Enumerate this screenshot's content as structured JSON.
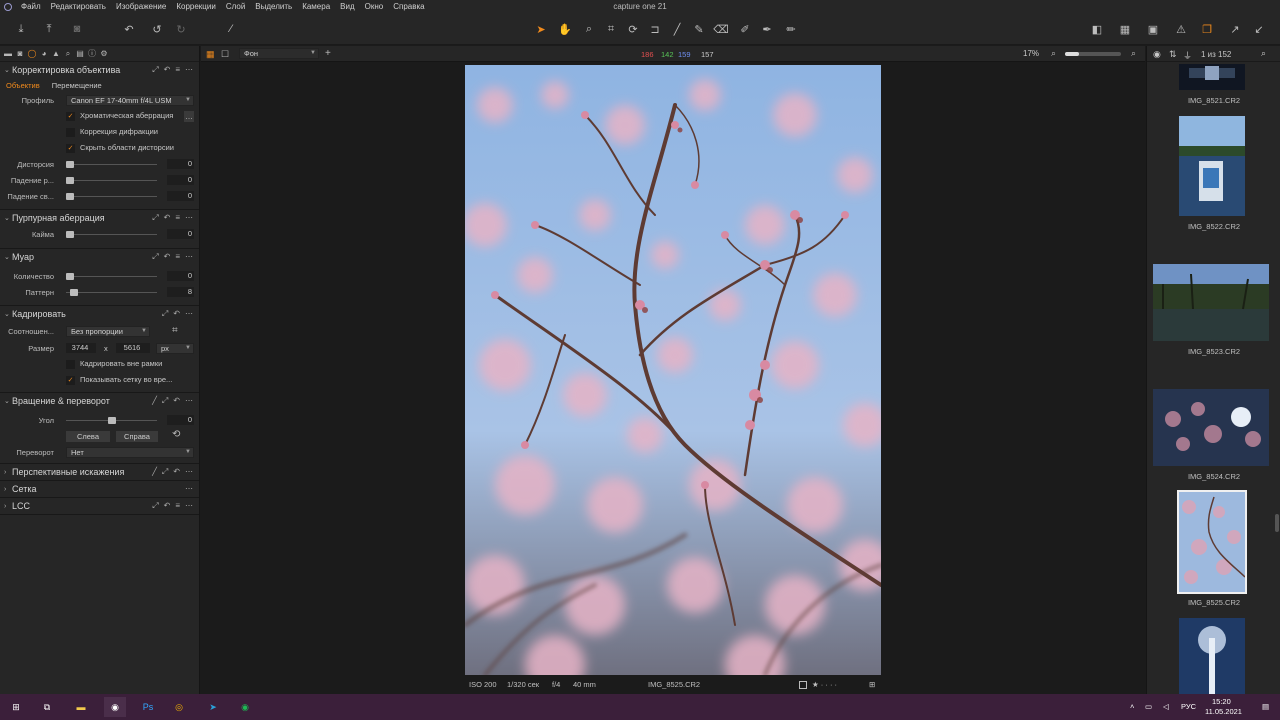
{
  "menubar": {
    "items": [
      "Файл",
      "Редактировать",
      "Изображение",
      "Коррекции",
      "Слой",
      "Выделить",
      "Камера",
      "Вид",
      "Окно",
      "Справка"
    ],
    "title": "capture one 21"
  },
  "viewer_bar": {
    "layer": "Фон",
    "rgb": {
      "r": "186",
      "g": "142",
      "b": "159",
      "l": "157"
    },
    "zoom": "17%"
  },
  "browser_bar": {
    "count": "1 из 152"
  },
  "lens_panel": {
    "title": "Корректировка объектива",
    "tabs": [
      "Объектив",
      "Перемещение"
    ],
    "profile_label": "Профиль",
    "profile_value": "Canon EF 17-40mm f/4L USM",
    "checks": [
      {
        "label": "Хроматическая аберрация",
        "checked": true
      },
      {
        "label": "Коррекция дифракции",
        "checked": false
      },
      {
        "label": "Скрыть области дисторсии",
        "checked": true
      }
    ],
    "sliders": [
      {
        "label": "Дисторсия",
        "value": "0"
      },
      {
        "label": "Падение р...",
        "value": "0"
      },
      {
        "label": "Падение св...",
        "value": "0"
      }
    ]
  },
  "purple_panel": {
    "title": "Пурпурная аберрация",
    "slider_label": "Кайма",
    "slider_value": "0"
  },
  "moire_panel": {
    "title": "Муар",
    "sliders": [
      {
        "label": "Количество",
        "value": "0"
      },
      {
        "label": "Паттерн",
        "value": "8"
      }
    ]
  },
  "crop_panel": {
    "title": "Кадрировать",
    "ratio_label": "Соотношен...",
    "ratio_value": "Без пропорции",
    "size_label": "Размер",
    "width": "3744",
    "x": "x",
    "height": "5616",
    "unit": "px",
    "checks": [
      {
        "label": "Кадрировать вне рамки",
        "checked": false
      },
      {
        "label": "Показывать сетку во вре...",
        "checked": true
      }
    ]
  },
  "rotate_panel": {
    "title": "Вращение & переворот",
    "angle_label": "Угол",
    "angle_value": "0",
    "left_btn": "Слева",
    "right_btn": "Справа",
    "flip_label": "Переворот",
    "flip_value": "Нет"
  },
  "collapsed_panels": [
    "Перспективные искажения",
    "Сетка",
    "LCC"
  ],
  "status": {
    "iso": "ISO 200",
    "shutter": "1/320 сек",
    "aperture": "f/4",
    "focal": "40 mm",
    "filename": "IMG_8525.CR2",
    "rating": "★ · · · ·"
  },
  "filmstrip": [
    {
      "name": "IMG_8521.CR2"
    },
    {
      "name": "IMG_8522.CR2"
    },
    {
      "name": "IMG_8523.CR2"
    },
    {
      "name": "IMG_8524.CR2"
    },
    {
      "name": "IMG_8525.CR2",
      "selected": true
    },
    {
      "name": ""
    }
  ],
  "taskbar": {
    "lang": "РУС",
    "time": "15:20",
    "date": "11.05.2021"
  },
  "colors": {
    "accent": "#f08a1c",
    "panel": "#262626",
    "bg": "#1b1b1b",
    "taskbar": "#3b1f3a"
  }
}
